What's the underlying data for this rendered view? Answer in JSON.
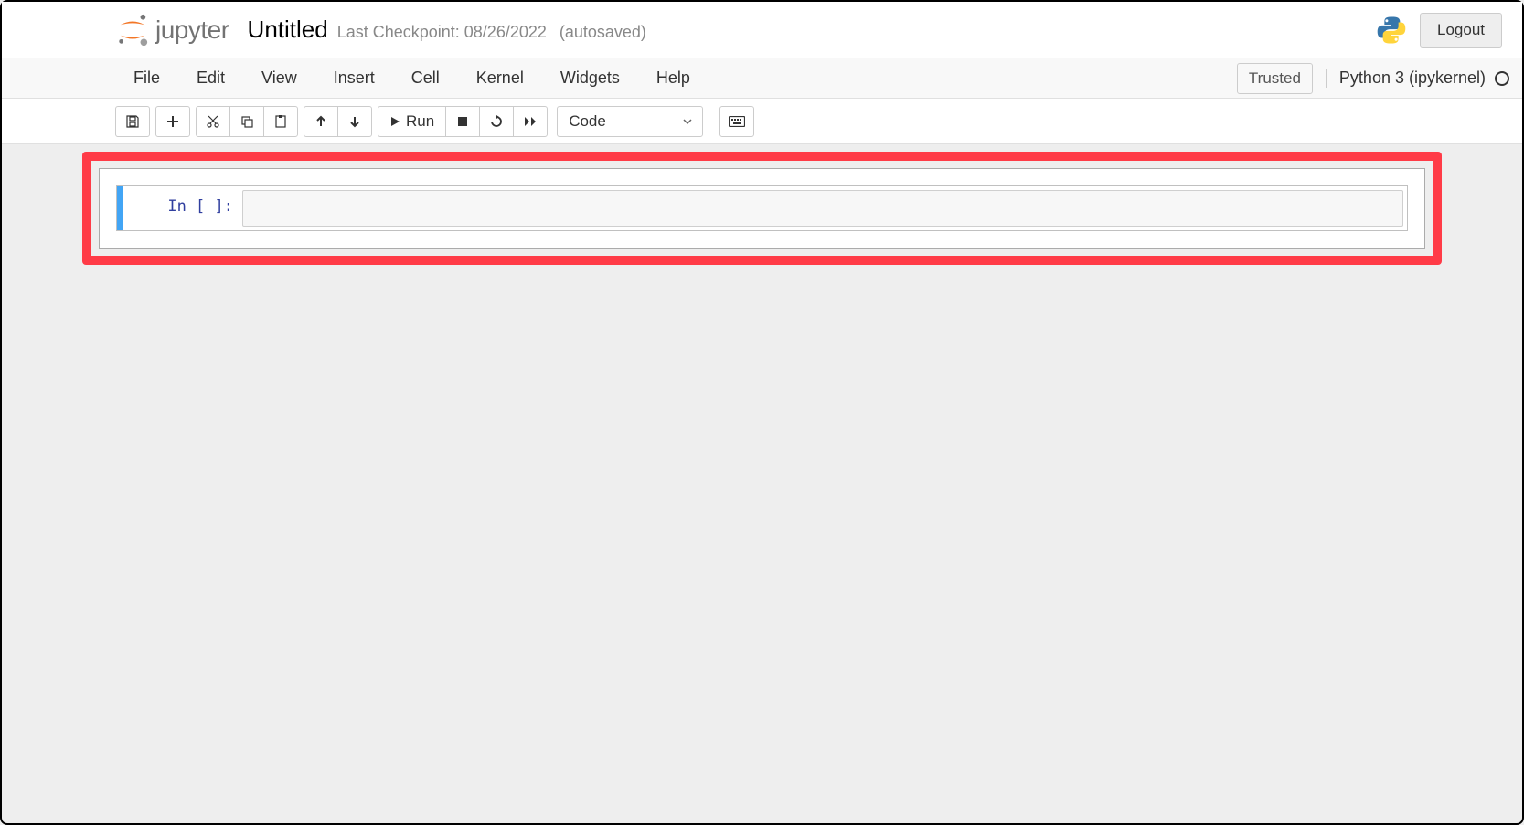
{
  "header": {
    "logo_text": "jupyter",
    "notebook_title": "Untitled",
    "checkpoint_text": "Last Checkpoint: 08/26/2022",
    "autosaved_text": "(autosaved)",
    "logout_label": "Logout"
  },
  "menubar": {
    "items": [
      "File",
      "Edit",
      "View",
      "Insert",
      "Cell",
      "Kernel",
      "Widgets",
      "Help"
    ],
    "trusted_label": "Trusted",
    "kernel_name": "Python 3 (ipykernel)"
  },
  "toolbar": {
    "run_label": "Run",
    "cell_type_value": "Code"
  },
  "cell": {
    "prompt": "In [ ]:",
    "content": ""
  }
}
